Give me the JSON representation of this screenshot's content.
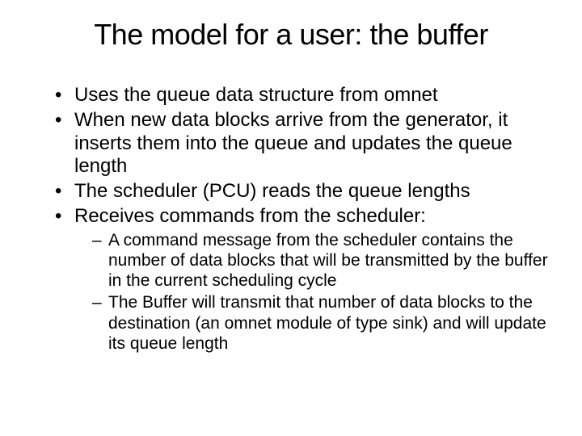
{
  "title": "The model for a user: the buffer",
  "bullets": {
    "b0": "Uses the queue data structure from omnet",
    "b1": "When new data blocks arrive from the generator, it inserts them into the queue and updates the queue length",
    "b2": "The scheduler (PCU) reads the queue lengths",
    "b3": "Receives commands from the scheduler:"
  },
  "sub": {
    "s0": "A command message from the scheduler contains the number of data blocks that will be transmitted by the buffer in the current scheduling cycle",
    "s1": "The Buffer will transmit that number of data blocks to the destination (an omnet module of type sink) and will update its queue length"
  }
}
